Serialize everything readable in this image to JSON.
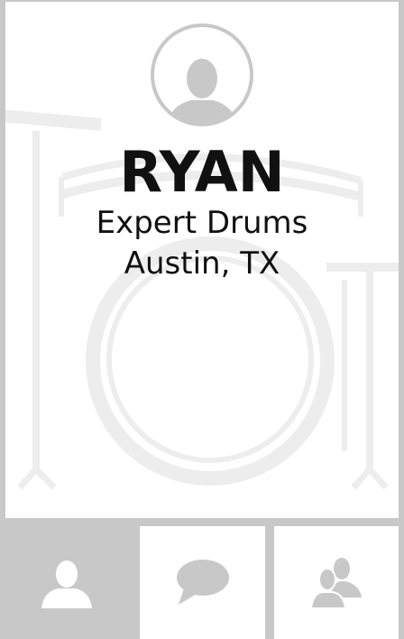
{
  "profile": {
    "name": "RYAN",
    "skill": "Expert Drums",
    "location": "Austin, TX"
  },
  "icons": {
    "avatar": "user-avatar-icon",
    "background": "drum-kit-illustration",
    "tabs": [
      "user-icon",
      "chat-bubble-icon",
      "users-icon"
    ]
  },
  "tabbar": {
    "active_tab": "profile"
  },
  "colors": {
    "background": "#c8c8c8",
    "card": "#ffffff",
    "text": "#111111",
    "icon_light": "#e6e6e6",
    "icon_gray": "#c8c8c8"
  }
}
